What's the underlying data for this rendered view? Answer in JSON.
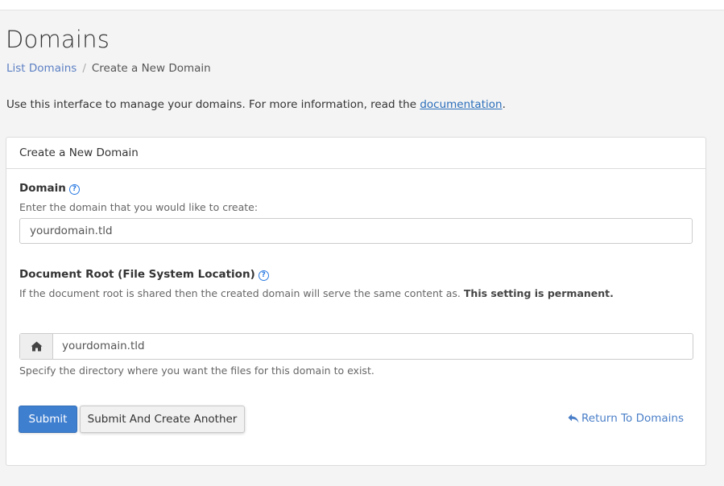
{
  "page": {
    "title": "Domains",
    "breadcrumb": {
      "parent_label": "List Domains",
      "separator": "/",
      "current_label": "Create a New Domain"
    },
    "intro": {
      "text_before": "Use this interface to manage your domains. For more information, read the ",
      "link_label": "documentation",
      "text_after": "."
    }
  },
  "panel": {
    "heading": "Create a New Domain",
    "domain_field": {
      "label": "Domain",
      "help_icon": "question-circle-icon",
      "help_text": "Enter the domain that you would like to create:",
      "value": "yourdomain.tld"
    },
    "docroot_field": {
      "label": "Document Root (File System Location)",
      "help_icon": "question-circle-icon",
      "help_text": "If the document root is shared then the created domain will serve the same content as.",
      "help_text_strong": "This setting is permanent.",
      "addon_icon": "home-icon",
      "value": "yourdomain.tld",
      "footer_help": "Specify the directory where you want the files for this domain to exist."
    },
    "actions": {
      "submit_label": "Submit",
      "submit_another_label": "Submit And Create Another",
      "return_icon": "reply-arrow-icon",
      "return_label": "Return To Domains"
    }
  },
  "colors": {
    "primary": "#3f7fd0",
    "link": "#4a7fc8",
    "background": "#f4f4f4"
  }
}
